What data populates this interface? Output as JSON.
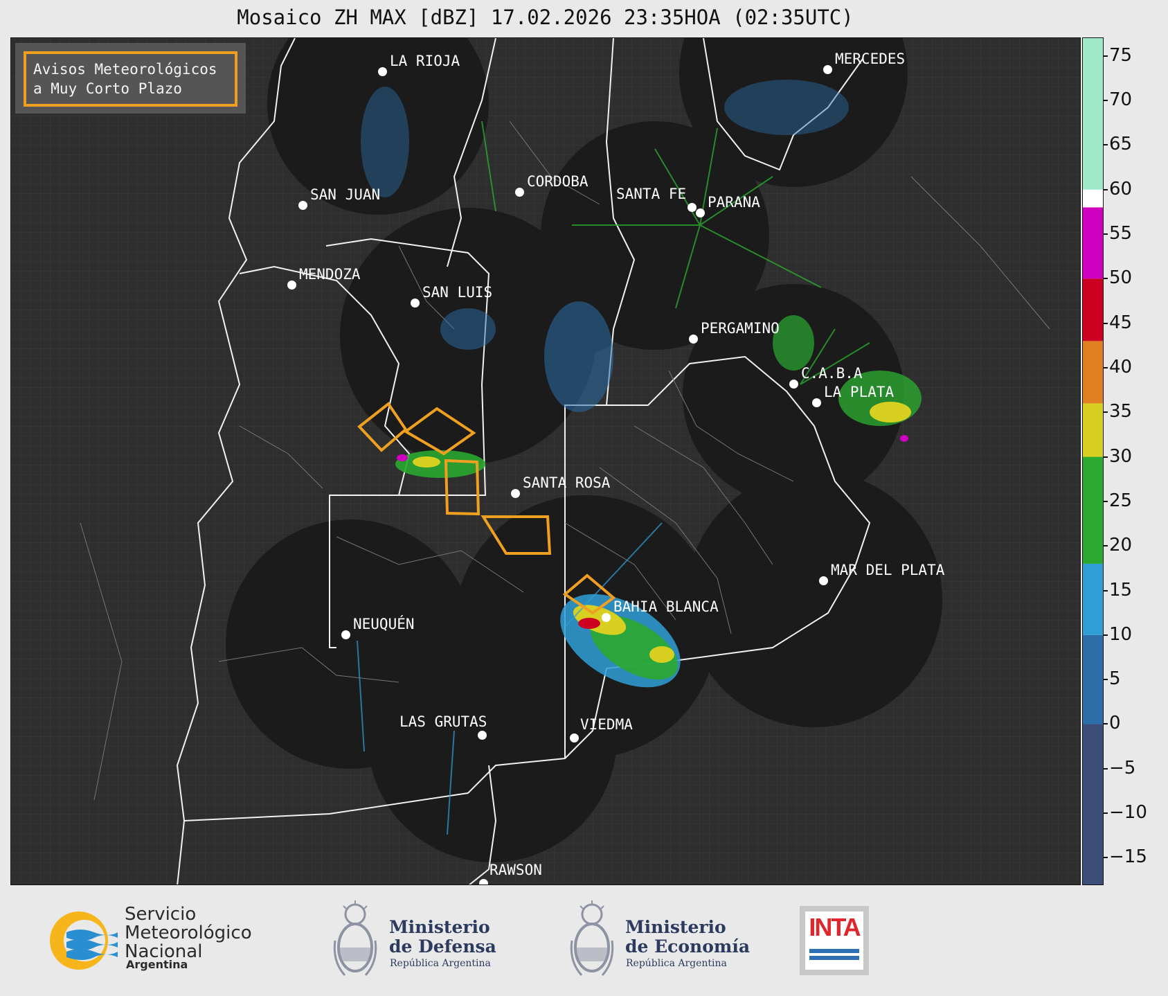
{
  "title": "Mosaico ZH MAX [dBZ] 17.02.2026 23:35HOA (02:35UTC)",
  "legend": {
    "line1": "Avisos Meteorológicos",
    "line2": "a Muy Corto Plazo",
    "border_color": "#f0a020"
  },
  "cities": [
    {
      "name": "LA RIOJA"
    },
    {
      "name": "MERCEDES"
    },
    {
      "name": "SAN JUAN"
    },
    {
      "name": "CORDOBA"
    },
    {
      "name": "SANTA FE"
    },
    {
      "name": "PARANA"
    },
    {
      "name": "MENDOZA"
    },
    {
      "name": "SAN LUIS"
    },
    {
      "name": "PERGAMINO"
    },
    {
      "name": "C.A.B.A"
    },
    {
      "name": "LA PLATA"
    },
    {
      "name": "SANTA ROSA"
    },
    {
      "name": "MAR DEL PLATA"
    },
    {
      "name": "BAHIA BLANCA"
    },
    {
      "name": "NEUQUÉN"
    },
    {
      "name": "LAS GRUTAS"
    },
    {
      "name": "VIEDMA"
    },
    {
      "name": "RAWSON"
    }
  ],
  "colorbar": {
    "unit": "dBZ",
    "min": -18,
    "max": 77,
    "ticks": [
      "75",
      "70",
      "65",
      "60",
      "55",
      "50",
      "45",
      "40",
      "35",
      "30",
      "25",
      "20",
      "15",
      "10",
      "5",
      "0",
      "−5",
      "−10",
      "−15"
    ],
    "tick_values": [
      75,
      70,
      65,
      60,
      55,
      50,
      45,
      40,
      35,
      30,
      25,
      20,
      15,
      10,
      5,
      0,
      -5,
      -10,
      -15
    ],
    "stops": [
      {
        "from": -18,
        "to": 0,
        "color": "#3d4d7a"
      },
      {
        "from": 0,
        "to": 10,
        "color": "#2c6ea8"
      },
      {
        "from": 10,
        "to": 18,
        "color": "#2f9fd6"
      },
      {
        "from": 18,
        "to": 30,
        "color": "#2aa830"
      },
      {
        "from": 30,
        "to": 36,
        "color": "#d8d020"
      },
      {
        "from": 36,
        "to": 43,
        "color": "#e08020"
      },
      {
        "from": 43,
        "to": 50,
        "color": "#cc0020"
      },
      {
        "from": 50,
        "to": 58,
        "color": "#d000c0"
      },
      {
        "from": 58,
        "to": 60,
        "color": "#ffffff"
      },
      {
        "from": 60,
        "to": 77,
        "color": "#9fe8c8"
      }
    ]
  },
  "logos": {
    "smn_line1": "Servicio",
    "smn_line2": "Meteorológico",
    "smn_line3": "Nacional",
    "smn_sub": "Argentina",
    "defensa_line1": "Ministerio",
    "defensa_line2": "de Defensa",
    "defensa_sub": "República Argentina",
    "economia_line1": "Ministerio",
    "economia_line2": "de Economía",
    "economia_sub": "República Argentina",
    "inta": "INTA"
  }
}
